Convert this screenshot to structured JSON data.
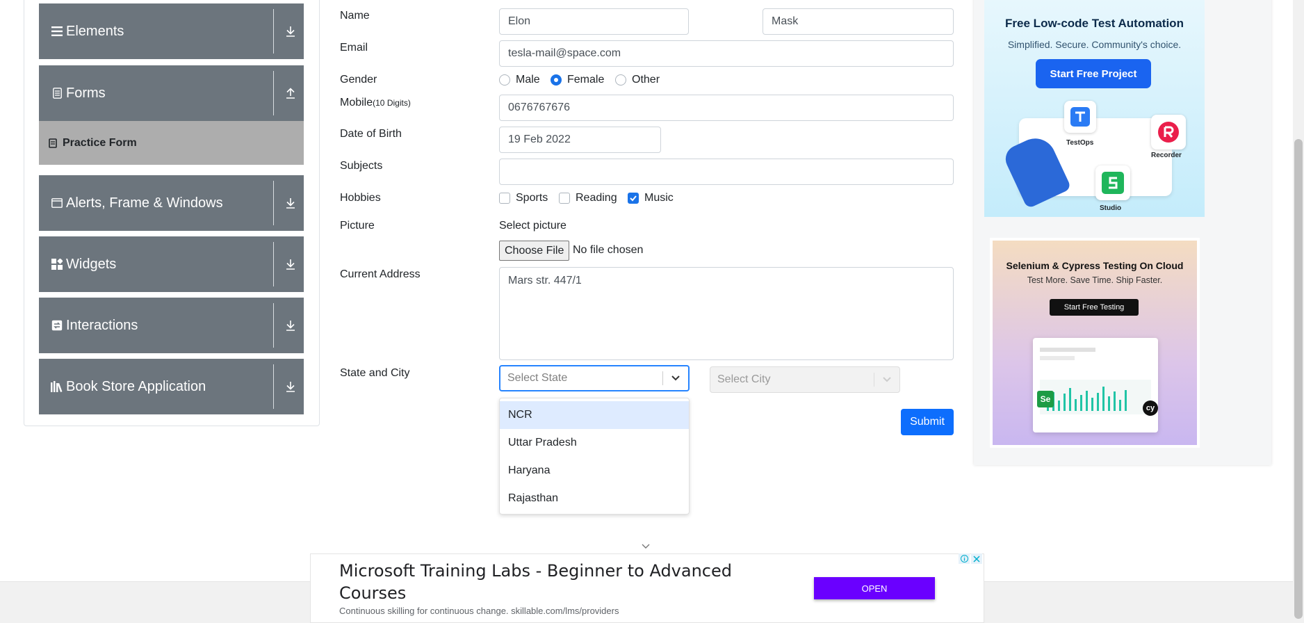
{
  "sidebar": {
    "groups": [
      {
        "label": "Elements",
        "icon": "hamburger-icon",
        "arrow": "download-arrow-icon"
      },
      {
        "label": "Forms",
        "icon": "document-icon",
        "arrow": "upload-arrow-icon"
      },
      {
        "label": "Alerts, Frame & Windows",
        "icon": "window-icon",
        "arrow": "download-arrow-icon"
      },
      {
        "label": "Widgets",
        "icon": "widgets-icon",
        "arrow": "download-arrow-icon"
      },
      {
        "label": "Interactions",
        "icon": "interactions-icon",
        "arrow": "download-arrow-icon"
      },
      {
        "label": "Book Store Application",
        "icon": "books-icon",
        "arrow": "download-arrow-icon"
      }
    ],
    "active_item": "Practice Form"
  },
  "form": {
    "name_label": "Name",
    "first_name": "Elon",
    "last_name": "Mask",
    "email_label": "Email",
    "email": "tesla-mail@space.com",
    "gender_label": "Gender",
    "genders": [
      "Male",
      "Female",
      "Other"
    ],
    "gender_selected": "Female",
    "mobile_label": "Mobile",
    "mobile_hint": "(10 Digits)",
    "mobile": "0676767676",
    "dob_label": "Date of Birth",
    "dob": "19 Feb 2022",
    "subjects_label": "Subjects",
    "hobbies_label": "Hobbies",
    "hobbies": [
      "Sports",
      "Reading",
      "Music"
    ],
    "hobbies_checked": [
      "Music"
    ],
    "picture_label": "Picture",
    "select_picture": "Select picture",
    "choose_file": "Choose File",
    "no_file": "No file chosen",
    "address_label": "Current Address",
    "address": "Mars str. 447/1",
    "state_city_label": "State and City",
    "state_placeholder": "Select State",
    "city_placeholder": "Select City",
    "state_options": [
      "NCR",
      "Uttar Pradesh",
      "Haryana",
      "Rajasthan"
    ],
    "submit": "Submit"
  },
  "ads": {
    "ad1_title": "Free Low-code Test Automation",
    "ad1_sub": "Simplified. Secure. Community's choice.",
    "ad1_cta": "Start Free Project",
    "ad1_labels": [
      "TestOps",
      "Recorder",
      "Studio"
    ],
    "ad2_title": "Selenium & Cypress Testing On Cloud",
    "ad2_sub": "Test More. Save Time. Ship Faster.",
    "ad2_cta": "Start Free Testing",
    "banner_title": "Microsoft Training Labs - Beginner to Advanced Courses",
    "banner_sub": "Continuous skilling for continuous change. skillable.com/lms/providers",
    "banner_cta": "OPEN"
  },
  "colors": {
    "sidebar_bg": "#6c757d",
    "active_item_bg": "#adadad",
    "primary": "#0d6efd",
    "select_focus": "#2684ff",
    "option_focus": "#deebff",
    "banner_cta": "#6a00ff"
  }
}
